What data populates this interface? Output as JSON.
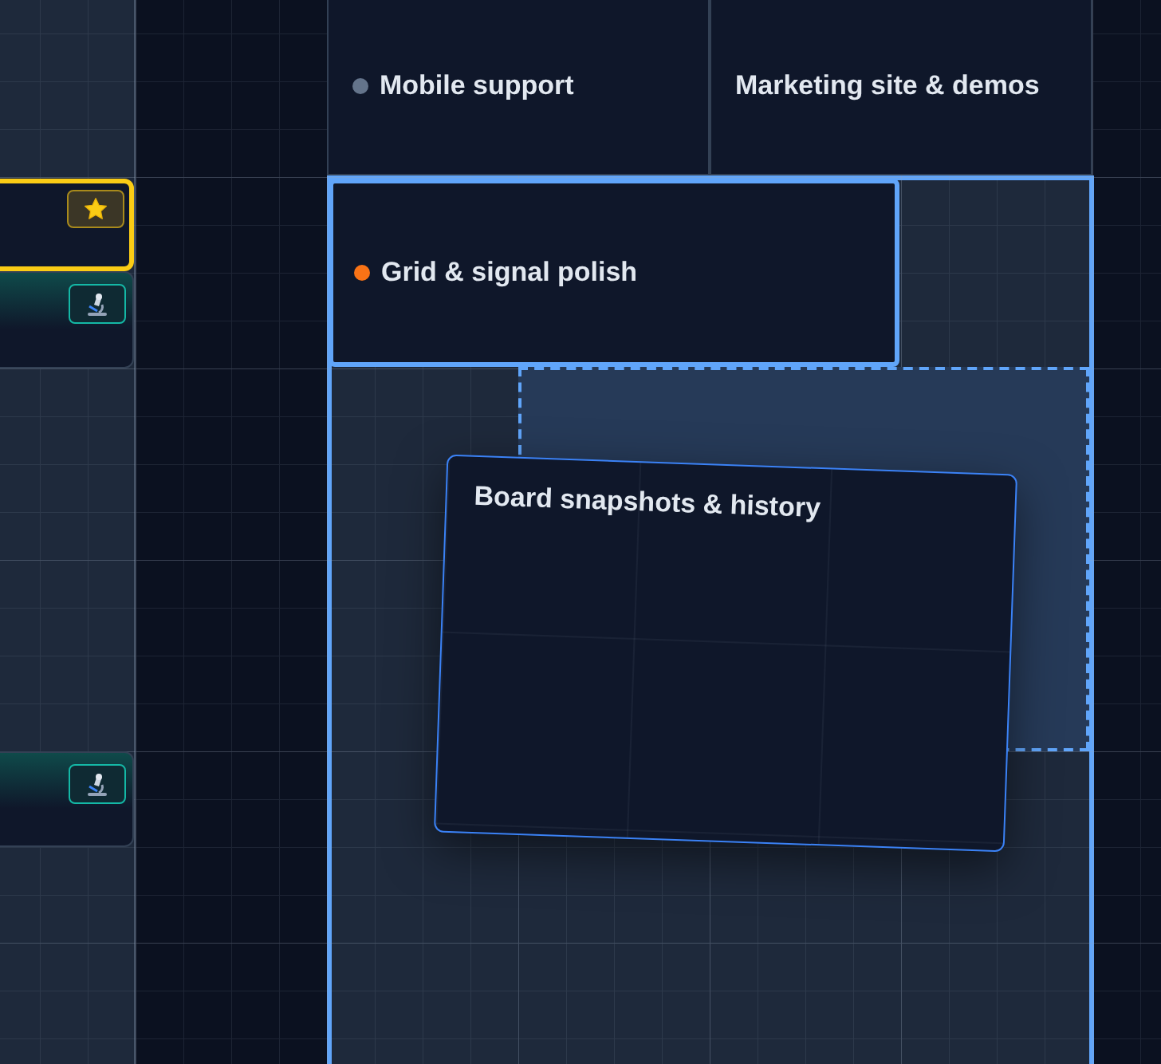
{
  "lanes": [
    {
      "selected": false
    },
    {
      "selected": true
    }
  ],
  "side_cards": [
    {
      "kind": "star",
      "highlighted": true
    },
    {
      "kind": "microscope",
      "highlighted": false
    },
    {
      "kind": "microscope",
      "highlighted": false
    }
  ],
  "cards": [
    {
      "title": "Mobile support",
      "color": "#64748b",
      "selected": false
    },
    {
      "title": "Marketing site & demos",
      "selected": false
    },
    {
      "title": "Grid & signal polish",
      "color": "#f97316",
      "selected": true
    }
  ],
  "drop_zone": {
    "visible": true
  },
  "dragged_card": {
    "title": "Board snapshots & history"
  }
}
